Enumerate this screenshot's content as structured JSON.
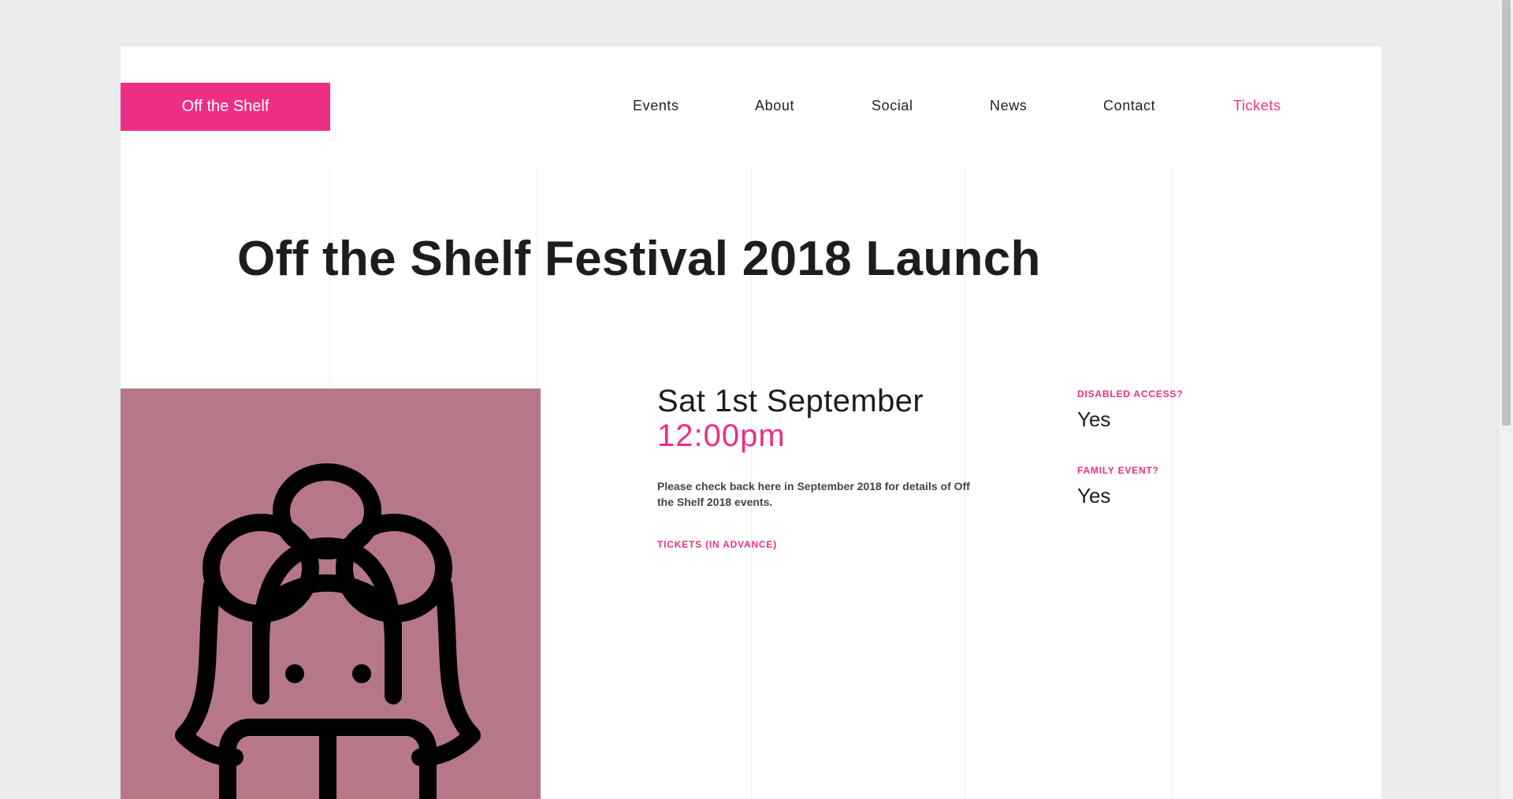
{
  "header": {
    "logo_text": "Off the Shelf",
    "nav": [
      {
        "label": "Events"
      },
      {
        "label": "About"
      },
      {
        "label": "Social"
      },
      {
        "label": "News"
      },
      {
        "label": "Contact"
      },
      {
        "label": "Tickets"
      }
    ],
    "active_nav": "Tickets"
  },
  "event": {
    "title": "Off the Shelf Festival 2018 Launch",
    "date": "Sat 1st September",
    "time": "12:00pm",
    "description": "Please check back here in September 2018 for details of Off the Shelf 2018 events.",
    "tickets_label": "TICKETS (IN ADVANCE)",
    "image_icon": "reading-person-illustration"
  },
  "details": {
    "disabled_access_label": "DISABLED ACCESS?",
    "disabled_access_value": "Yes",
    "family_event_label": "FAMILY EVENT?",
    "family_event_value": "Yes"
  },
  "colors": {
    "brand": "#ec2f84",
    "hero_bg": "#b67888",
    "page_bg": "#ebebeb",
    "text": "#1d1d1d"
  }
}
